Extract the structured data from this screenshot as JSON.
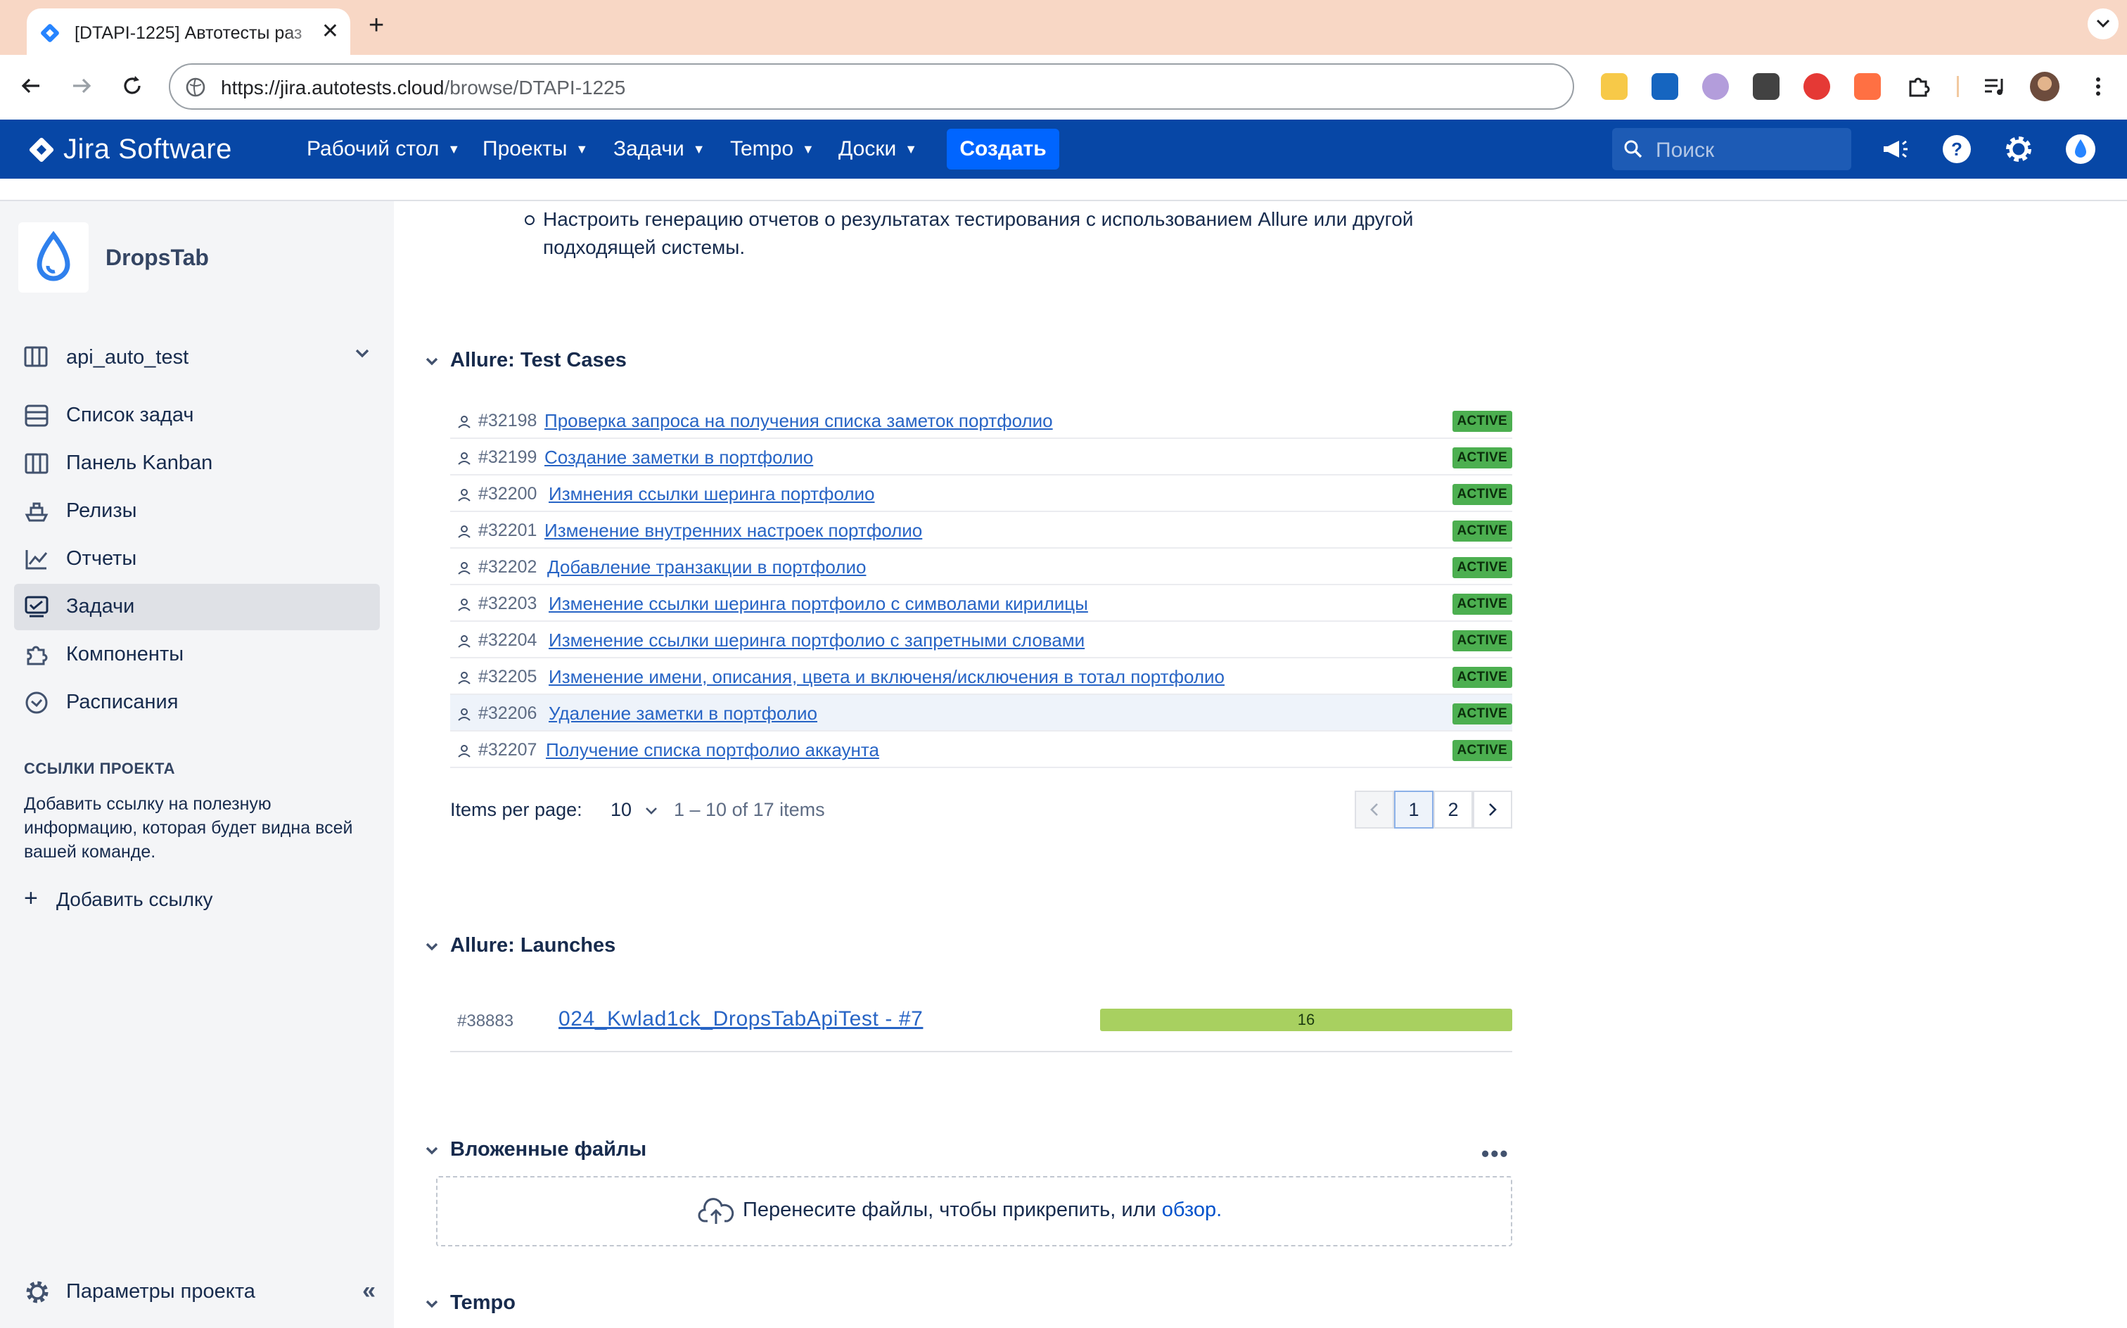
{
  "browser": {
    "tab_title": "[DTAPI-1225] Автотесты раз",
    "url_host": "https://jira.autotests.cloud",
    "url_path": "/browse/DTAPI-1225",
    "extension_icons": [
      "pencil-ext-icon",
      "bookmark-ext-icon",
      "cloud-ext-icon",
      "selenium-ext-icon",
      "strawberry-ext-icon",
      "robot-ext-icon",
      "puzzle-icon",
      "media-icon"
    ]
  },
  "header": {
    "logo_text": "Jira Software",
    "nav": [
      {
        "label": "Рабочий стол"
      },
      {
        "label": "Проекты"
      },
      {
        "label": "Задачи"
      },
      {
        "label": "Tempo"
      },
      {
        "label": "Доски"
      }
    ],
    "create_label": "Создать",
    "search_placeholder": "Поиск"
  },
  "sidebar": {
    "project_name": "DropsTab",
    "board_name": "api_auto_test",
    "items": [
      {
        "label": "Список задач",
        "icon": "backlog-icon"
      },
      {
        "label": "Панель Kanban",
        "icon": "board-icon"
      },
      {
        "label": "Релизы",
        "icon": "ship-icon"
      },
      {
        "label": "Отчеты",
        "icon": "chart-icon"
      },
      {
        "label": "Задачи",
        "icon": "issues-icon",
        "active": true
      },
      {
        "label": "Компоненты",
        "icon": "puzzle-icon"
      },
      {
        "label": "Расписания",
        "icon": "schedule-icon"
      }
    ],
    "links_title": "ССЫЛКИ ПРОЕКТА",
    "links_desc": "Добавить ссылку на полезную информацию, которая будет видна всей вашей команде.",
    "add_link_label": "Добавить ссылку",
    "settings_label": "Параметры проекта"
  },
  "main": {
    "description_item": "Настроить генерацию отчетов о результатах тестирования с использованием Allure или другой подходящей системы.",
    "test_cases": {
      "title": "Allure: Test Cases",
      "rows": [
        {
          "id": "#32198",
          "name": "Проверка запроса на получения списка заметок портфолио",
          "status": "ACTIVE"
        },
        {
          "id": "#32199",
          "name": "Создание заметки в портфолио",
          "status": "ACTIVE"
        },
        {
          "id": "#32200",
          "name": "Измнения ссылки шеринга портфолио",
          "status": "ACTIVE"
        },
        {
          "id": "#32201",
          "name": "Изменение внутренних настроек портфолио",
          "status": "ACTIVE"
        },
        {
          "id": "#32202",
          "name": "Добавление транзакции в портфолио",
          "status": "ACTIVE"
        },
        {
          "id": "#32203",
          "name": "Изменение ссылки шеринга портфоило с символами кирилицы",
          "status": "ACTIVE"
        },
        {
          "id": "#32204",
          "name": "Изменение ссылки шеринга портфолио с запретными словами",
          "status": "ACTIVE"
        },
        {
          "id": "#32205",
          "name": "Изменение имени, описания, цвета и включеня/исключения в тотал портфолио",
          "status": "ACTIVE"
        },
        {
          "id": "#32206",
          "name": "Удаление заметки в портфолио",
          "status": "ACTIVE"
        },
        {
          "id": "#32207",
          "name": "Получение списка портфолио аккаунта",
          "status": "ACTIVE"
        }
      ],
      "items_per_page_label": "Items per page:",
      "items_per_page_value": "10",
      "range_text": "1 – 10 of 17 items",
      "pages": [
        "1",
        "2"
      ],
      "current_page": "1"
    },
    "launches": {
      "title": "Allure: Launches",
      "rows": [
        {
          "id": "#38883",
          "name": "024_Kwlad1ck_DropsTabApiTest - #7",
          "passed": 16,
          "passed_fraction": 1.0
        }
      ]
    },
    "attachments": {
      "title": "Вложенные файлы",
      "drop_text": "Перенесите файлы, чтобы прикрепить, или",
      "browse_link": "обзор",
      "browse_suffix": "."
    },
    "tempo": {
      "title": "Tempo"
    }
  },
  "colors": {
    "jira_header": "#0747a6",
    "create_button": "#0065ff",
    "link": "#2764c5",
    "active_badge": "#4caf50",
    "launch_bar": "#a8d060",
    "tab_strip": "#f8d7c5"
  }
}
